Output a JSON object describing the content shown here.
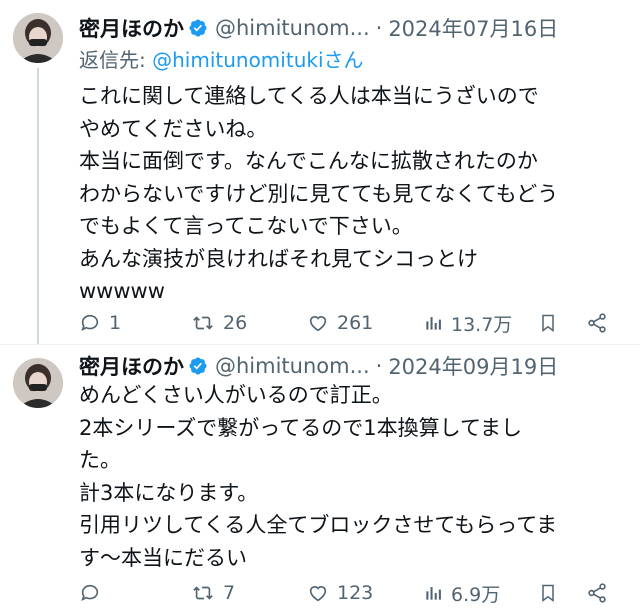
{
  "tweets": [
    {
      "display_name": "密月ほのか",
      "handle": "@himitunom...",
      "separator": "·",
      "date": "2024年07月16日",
      "reply_prefix": "返信先: ",
      "reply_handle": "@himitunomitukiさん",
      "lines": [
        "これに関して連絡してくる人は本当にうざいので",
        "やめてくださいね。",
        "本当に面倒です。なんでこんなに拡散されたのか",
        "わからないですけど別に見てても見てなくてもどう",
        "でもよくて言ってこないで下さい。",
        "あんな演技が良ければそれ見てシコっとけ",
        "wwwww"
      ],
      "replies": "1",
      "retweets": "26",
      "likes": "261",
      "views": "13.7万"
    },
    {
      "display_name": "密月ほのか",
      "handle": "@himitunom...",
      "separator": "·",
      "date": "2024年09月19日",
      "lines": [
        "めんどくさい人がいるので訂正。",
        "2本シリーズで繋がってるので1本換算してまし",
        "た。",
        "計3本になります。",
        "引用リツしてくる人全てブロックさせてもらってま",
        "す〜本当にだるい"
      ],
      "replies": "",
      "retweets": "7",
      "likes": "123",
      "views": "6.9万"
    }
  ],
  "colors": {
    "text": "#0f1419",
    "secondary": "#536471",
    "link": "#1d9bf0",
    "verified": "#1d9bf0"
  }
}
